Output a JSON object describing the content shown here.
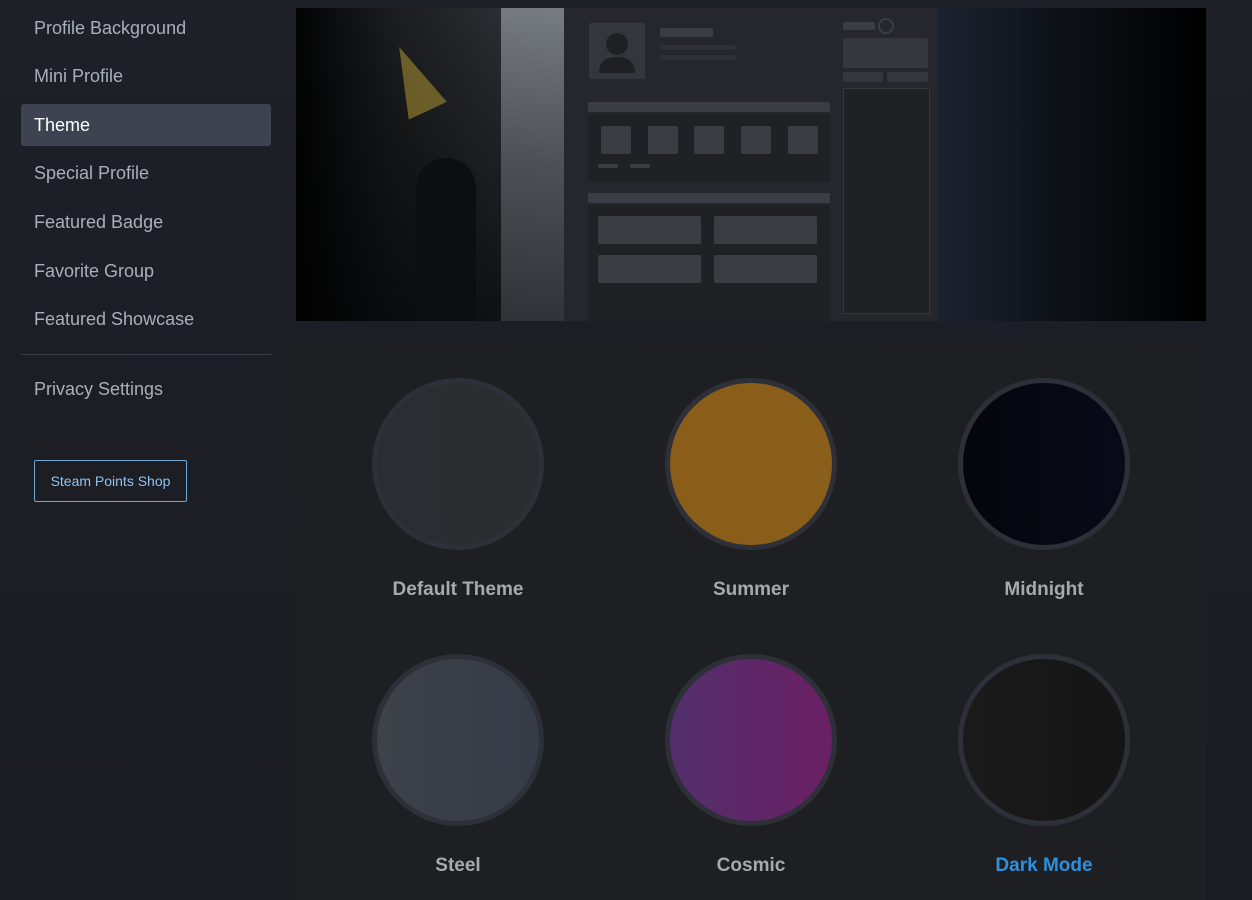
{
  "sidebar": {
    "items": [
      {
        "label": "Profile Background",
        "active": false
      },
      {
        "label": "Mini Profile",
        "active": false
      },
      {
        "label": "Theme",
        "active": true
      },
      {
        "label": "Special Profile",
        "active": false
      },
      {
        "label": "Featured Badge",
        "active": false
      },
      {
        "label": "Favorite Group",
        "active": false
      },
      {
        "label": "Featured Showcase",
        "active": false
      }
    ],
    "privacy_label": "Privacy Settings",
    "shop_button_label": "Steam Points Shop"
  },
  "themes": [
    {
      "name": "Default Theme",
      "color_from": "#2a2d31",
      "color_to": "#2a2c30",
      "selected": false
    },
    {
      "name": "Summer",
      "color_from": "#8a5d18",
      "color_to": "#8a5f1b",
      "selected": false
    },
    {
      "name": "Midnight",
      "color_from": "#05060b",
      "color_to": "#080a19",
      "selected": false
    },
    {
      "name": "Steel",
      "color_from": "#3e4249",
      "color_to": "#353c47",
      "selected": false
    },
    {
      "name": "Cosmic",
      "color_from": "#522f6b",
      "color_to": "#6a2064",
      "selected": false
    },
    {
      "name": "Dark Mode",
      "color_from": "#1a1a1a",
      "color_to": "#151515",
      "selected": true
    }
  ],
  "accent_color": "#2d8fe0"
}
